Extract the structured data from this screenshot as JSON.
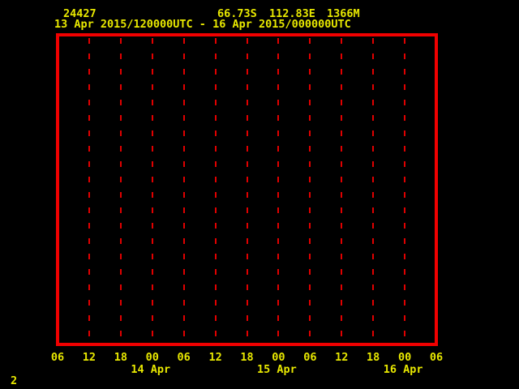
{
  "colors": {
    "background": "#000000",
    "frame_red": "#f10000",
    "grid_red": "#e00000",
    "text_yellow": "#e8e800"
  },
  "header": {
    "station_id": "24427",
    "latitude": "66.73S",
    "longitude": "112.83E",
    "elevation": "1366M",
    "time_range": "13 Apr 2015/120000UTC - 16 Apr 2015/000000UTC"
  },
  "page_indicator": "2",
  "chart_data": {
    "type": "line",
    "title": "",
    "description": "Empty meteogram time-series frame; no data series plotted inside the axes",
    "x_axis": {
      "tick_labels": [
        "06",
        "12",
        "18",
        "00",
        "06",
        "12",
        "18",
        "00",
        "06",
        "12",
        "18",
        "00",
        "06"
      ],
      "tick_interval_hours": 6,
      "day_labels": [
        {
          "label": "14 Apr",
          "tick_index": 3
        },
        {
          "label": "15 Apr",
          "tick_index": 7
        },
        {
          "label": "16 Apr",
          "tick_index": 11
        }
      ]
    },
    "grid": {
      "vertical_dashed": true,
      "gridline_count": 11
    },
    "series": []
  }
}
